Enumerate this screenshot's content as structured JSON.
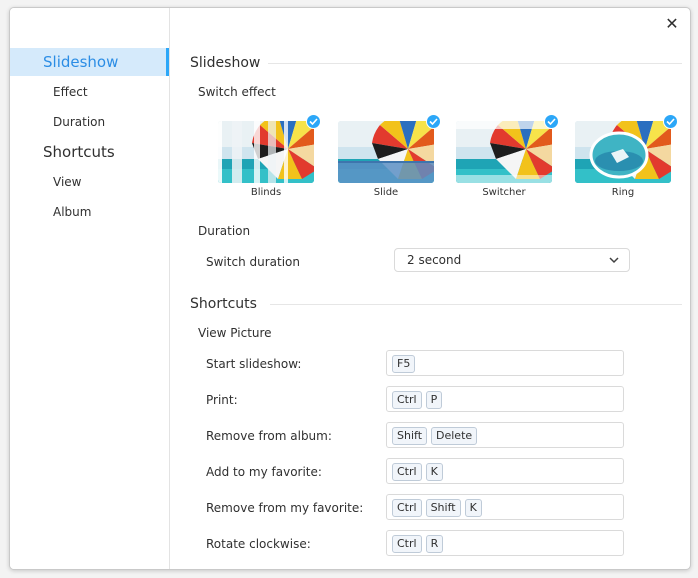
{
  "window": {
    "close_symbol": "✕"
  },
  "sidebar": {
    "items": [
      {
        "label": "Slideshow",
        "level": "group",
        "active": true
      },
      {
        "label": "Effect",
        "level": "sub"
      },
      {
        "label": "Duration",
        "level": "sub"
      },
      {
        "label": "Shortcuts",
        "level": "group"
      },
      {
        "label": "View",
        "level": "sub"
      },
      {
        "label": "Album",
        "level": "sub"
      }
    ]
  },
  "slideshow": {
    "title": "Slideshow",
    "switch_effect": {
      "label": "Switch effect",
      "effects": [
        {
          "label": "Blinds",
          "selected": true
        },
        {
          "label": "Slide",
          "selected": true
        },
        {
          "label": "Switcher",
          "selected": true
        },
        {
          "label": "Ring",
          "selected": true
        }
      ]
    },
    "duration": {
      "label": "Duration",
      "switch_label": "Switch duration",
      "value": "2 second"
    }
  },
  "shortcuts": {
    "title": "Shortcuts",
    "view_picture": {
      "label": "View Picture",
      "rows": [
        {
          "label": "Start slideshow:",
          "keys": [
            "F5"
          ]
        },
        {
          "label": "Print:",
          "keys": [
            "Ctrl",
            "P"
          ]
        },
        {
          "label": "Remove from album:",
          "keys": [
            "Shift",
            "Delete"
          ]
        },
        {
          "label": "Add to my favorite:",
          "keys": [
            "Ctrl",
            "K"
          ]
        },
        {
          "label": "Remove from my favorite:",
          "keys": [
            "Ctrl",
            "Shift",
            "K"
          ]
        },
        {
          "label": "Rotate clockwise:",
          "keys": [
            "Ctrl",
            "R"
          ]
        }
      ]
    }
  },
  "colors": {
    "accent": "#2ca7f8",
    "active_bg": "#d5eafb",
    "active_text": "#2b8de5"
  }
}
